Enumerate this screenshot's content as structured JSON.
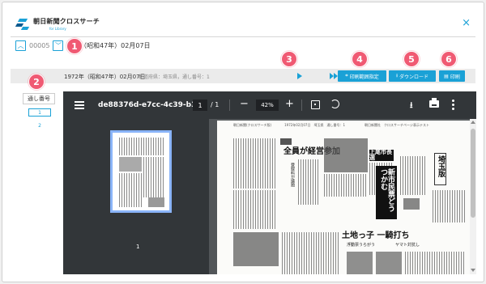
{
  "header": {
    "logo_title": "朝日新聞クロスサーチ",
    "logo_subtitle": "for Library",
    "close_symbol": "×"
  },
  "navigation": {
    "record_id": "00005",
    "issue_date": "年（昭和47年）02月07日"
  },
  "toolbar": {
    "issue_date": "1972年（昭和47年）02月07日",
    "metadata": "都道府県：埼玉県，通し番号：1",
    "print_range_label": "印刷範囲指定",
    "download_label": "ダウンロード",
    "print_label": "印刷"
  },
  "page_list": {
    "header": "通し番号",
    "items": [
      "1",
      "2"
    ],
    "selected_index": 0
  },
  "pdf_viewer": {
    "document_name": "de88376d-e7cc-4c39-b3...",
    "current_page": "1",
    "total_pages": "/ 1",
    "zoom": "42%",
    "zoom_out_symbol": "−",
    "zoom_in_symbol": "+",
    "thumbnail_page_number": "1",
    "page_header_text": "朝日新聞(クロスサーチ版)　　　　1972年02月07日　埼玉県　通し番号：1　　　　　　朝日新聞社　クロスサーチページ表示テスト",
    "newspaper_headlines": [
      "全員が経営参加",
      "新市民票どうつかむ",
      "土地っ子 一騎打ち",
      "埼玉版",
      "上尾市長選"
    ],
    "newspaper_subheads": [
      "登録料が議題",
      "浮動票うらがう",
      "ヤマト対抗し"
    ]
  },
  "callouts": [
    "1",
    "2",
    "3",
    "4",
    "5",
    "6"
  ],
  "colors": {
    "accent": "#1aa1d6",
    "callout": "#f05a73",
    "viewer_toolbar": "#323639",
    "viewer_background": "#525659"
  }
}
